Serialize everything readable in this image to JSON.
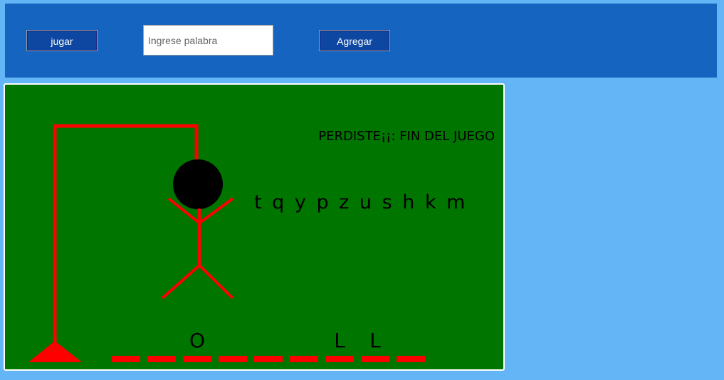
{
  "toolbar": {
    "play_label": "jugar",
    "word_input_placeholder": "Ingrese palabra",
    "word_input_value": "",
    "add_label": "Agregar"
  },
  "game": {
    "status": "PERDISTE¡¡: FIN DEL JUEGO",
    "wrong_letters": "t q y p z u s h k m",
    "slots": [
      "",
      "",
      "O",
      "",
      "",
      "",
      "L",
      "L",
      ""
    ],
    "colors": {
      "board": "#007500",
      "gallows": "#ff0000",
      "head": "#000000",
      "text": "#000000"
    }
  }
}
